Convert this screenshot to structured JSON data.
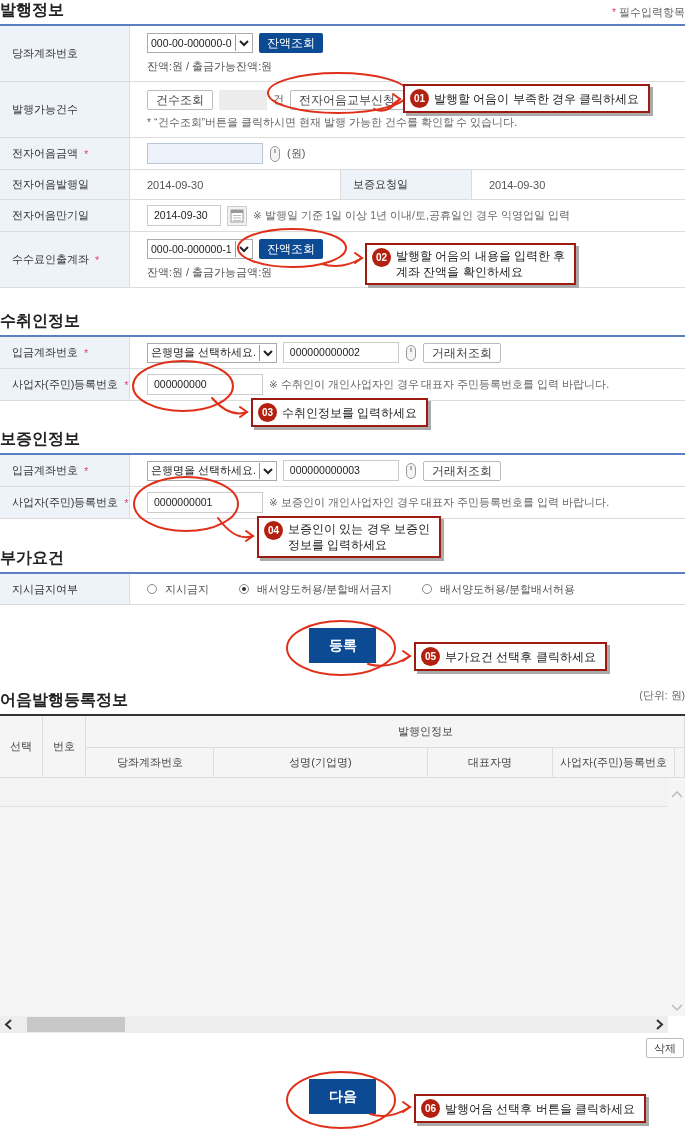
{
  "required_symbol": "*",
  "sections": [
    {
      "heading": {
        "title": "발행정보",
        "note": "필수입력항목"
      },
      "rows": [
        {
          "pairs": [
            {
              "label": "당좌계좌번호",
              "required": false,
              "lines": [
                [
                  {
                    "kind": "select",
                    "value": "000-00-000000-0"
                  },
                  {
                    "kind": "primary_button",
                    "label": "잔액조회"
                  }
                ],
                [
                  {
                    "kind": "text",
                    "text": "잔액:원 / 출금가능잔액:원"
                  }
                ]
              ]
            }
          ]
        },
        {
          "pairs": [
            {
              "label": "발행가능건수",
              "required": false,
              "lines": [
                [
                  {
                    "kind": "button",
                    "label": "건수조회"
                  },
                  {
                    "kind": "display"
                  },
                  {
                    "kind": "text",
                    "text": "건"
                  },
                  {
                    "kind": "button",
                    "label": "전자어음교부신청"
                  }
                ],
                [
                  {
                    "kind": "hint",
                    "text": "* “건수조회”버튼을 클릭하시면 현재 발행 가능한 건수를 확인할 수 있습니다."
                  }
                ]
              ]
            }
          ]
        },
        {
          "pairs": [
            {
              "label": "전자어음금액",
              "required": true,
              "lines": [
                [
                  {
                    "kind": "secure_input"
                  },
                  {
                    "kind": "text",
                    "text": "(원)"
                  }
                ]
              ]
            }
          ]
        },
        {
          "pairs": [
            {
              "label": "전자어음발행일",
              "required": false,
              "lines": [
                [
                  {
                    "kind": "text",
                    "text": "2014-09-30"
                  }
                ]
              ]
            },
            {
              "label": "보증요청일",
              "required": false,
              "lines": [
                [
                  {
                    "kind": "text",
                    "text": "2014-09-30"
                  }
                ]
              ]
            }
          ]
        },
        {
          "pairs": [
            {
              "label": "전자어음만기일",
              "required": false,
              "lines": [
                [
                  {
                    "kind": "date",
                    "value": "2014-09-30"
                  },
                  {
                    "kind": "hint",
                    "text": "※ 발행일 기준 1일 이상 1년 이내/토,공휴일인 경우 익영업일 입력"
                  }
                ]
              ]
            }
          ]
        },
        {
          "pairs": [
            {
              "label": "수수료인출계좌",
              "required": true,
              "lines": [
                [
                  {
                    "kind": "select",
                    "value": "000-00-000000-1"
                  },
                  {
                    "kind": "primary_button",
                    "label": "잔액조회"
                  }
                ],
                [
                  {
                    "kind": "text",
                    "text": "잔액:원 / 출금가능금액:원"
                  }
                ]
              ]
            }
          ]
        }
      ]
    },
    {
      "heading": {
        "title": "수취인정보"
      },
      "rows": [
        {
          "pairs": [
            {
              "label": "입금계좌번호",
              "required": true,
              "lines": [
                [
                  {
                    "kind": "select",
                    "value": "은행명을 선택하세요."
                  },
                  {
                    "kind": "secure_input",
                    "value": "000000000002"
                  },
                  {
                    "kind": "button",
                    "label": "거래처조회"
                  }
                ]
              ]
            }
          ]
        },
        {
          "pairs": [
            {
              "label": "사업자(주민)등록번호",
              "required": true,
              "lines": [
                [
                  {
                    "kind": "input",
                    "value": "000000000"
                  },
                  {
                    "kind": "hint",
                    "text": "※ 수취인이 개인사업자인 경우 대표자 주민등록번호를 입력 바랍니다."
                  }
                ]
              ]
            }
          ]
        }
      ]
    },
    {
      "heading": {
        "title": "보증인정보"
      },
      "rows": [
        {
          "pairs": [
            {
              "label": "입금계좌번호",
              "required": true,
              "lines": [
                [
                  {
                    "kind": "select",
                    "value": "은행명을 선택하세요."
                  },
                  {
                    "kind": "secure_input",
                    "value": "000000000003"
                  },
                  {
                    "kind": "button",
                    "label": "거래처조회"
                  }
                ]
              ]
            }
          ]
        },
        {
          "pairs": [
            {
              "label": "사업자(주민)등록번호",
              "required": true,
              "lines": [
                [
                  {
                    "kind": "input",
                    "value": "0000000001"
                  },
                  {
                    "kind": "hint",
                    "text": "※ 보증인이 개인사업자인 경우 대표자 주민등록번호를 입력 바랍니다."
                  }
                ]
              ]
            }
          ]
        }
      ]
    },
    {
      "heading": {
        "title": "부가요건"
      },
      "rows": [
        {
          "pairs": [
            {
              "label": "지시금지여부",
              "required": false,
              "lines": [
                [
                  {
                    "kind": "radio",
                    "label": "지시금지",
                    "selected": false
                  },
                  {
                    "kind": "radio",
                    "label": "배서양도허용/분할배서금지",
                    "selected": true
                  },
                  {
                    "kind": "radio",
                    "label": "배서양도허용/분할배서허용",
                    "selected": false
                  }
                ]
              ]
            }
          ]
        }
      ]
    }
  ],
  "register_button": "등록",
  "registration_table": {
    "heading": {
      "title": "어음발행등록정보",
      "unit": "(단위: 원)"
    },
    "columns": [
      "선택",
      "번호"
    ],
    "group_header": "발행인정보",
    "group_columns": [
      "당좌계좌번호",
      "성명(기업명)",
      "대표자명",
      "사업자(주민)등록번호"
    ]
  },
  "delete_button": "삭제",
  "next_button": "다음",
  "annotations": [
    {
      "number": "01",
      "text": "발행할 어음이 부족한 경우 클릭하세요"
    },
    {
      "number": "02",
      "text": "발행할 어음의 내용을 입력한 후\n계좌 잔액을 확인하세요"
    },
    {
      "number": "03",
      "text": "수취인정보를 입력하세요"
    },
    {
      "number": "04",
      "text": "보증인이 있는 경우 보증인\n정보를 입력하세요"
    },
    {
      "number": "05",
      "text": "부가요건 선택후 클릭하세요"
    },
    {
      "number": "06",
      "text": "발행어음 선택후 버튼을 클릭하세요"
    }
  ]
}
